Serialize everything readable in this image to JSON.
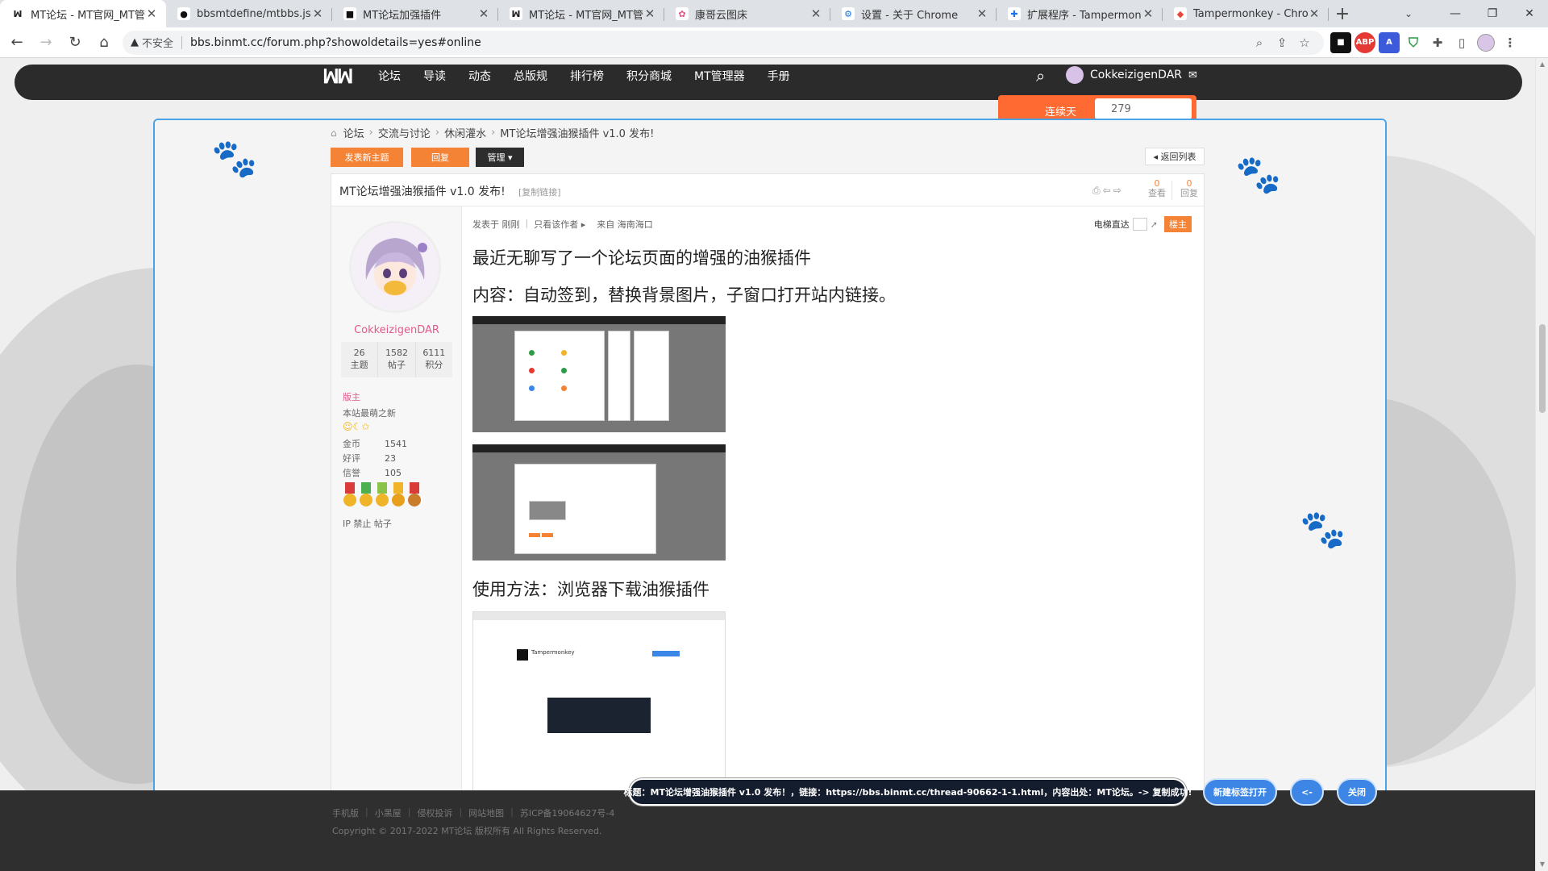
{
  "browser": {
    "tabs": [
      {
        "title": "MT论坛 - MT官网_MT管理器",
        "fav": "ꟽ",
        "fav_bg": "#ffffff",
        "fav_color": "#222222",
        "active": true
      },
      {
        "title": "bbsmtdefine/mtbbs.js at",
        "fav": "●",
        "fav_bg": "#ffffff",
        "fav_color": "#111111",
        "active": false
      },
      {
        "title": "MT论坛加强插件",
        "fav": "■",
        "fav_bg": "#ffffff",
        "fav_color": "#111111",
        "active": false
      },
      {
        "title": "MT论坛 - MT官网_MT管理器",
        "fav": "ꟽ",
        "fav_bg": "#ffffff",
        "fav_color": "#222222",
        "active": false
      },
      {
        "title": "康哥云图床",
        "fav": "✿",
        "fav_bg": "#ffffff",
        "fav_color": "#e0508c",
        "active": false
      },
      {
        "title": "设置 - 关于 Chrome",
        "fav": "⚙",
        "fav_bg": "#ffffff",
        "fav_color": "#1a73e8",
        "active": false
      },
      {
        "title": "扩展程序 - Tampermonkey",
        "fav": "✚",
        "fav_bg": "#ffffff",
        "fav_color": "#1a73e8",
        "active": false
      },
      {
        "title": "Tampermonkey - Chrome",
        "fav": "◆",
        "fav_bg": "#ffffff",
        "fav_color": "#e8453c",
        "active": false
      }
    ],
    "new_tab": "+",
    "insecure_label": "不安全",
    "url": "bbs.binmt.cc/forum.php?showoldetails=yes#online"
  },
  "site": {
    "logo": "ꟽꟽ",
    "nav": [
      "论坛",
      "导读",
      "动态",
      "总版规",
      "排行榜",
      "积分商城",
      "MT管理器",
      "手册"
    ],
    "username": "CokkeizigenDAR",
    "peek_label": "连续天",
    "peek_count": "279"
  },
  "thread": {
    "breadcrumb": [
      "论坛",
      "交流与讨论",
      "休闲灌水",
      "MT论坛增强油猴插件 v1.0 发布!"
    ],
    "new_topic": "发表新主题",
    "reply": "回复",
    "manage": "管理 ▾",
    "back": "◂ 返回列表",
    "title": "MT论坛增强油猴插件 v1.0 发布!",
    "copy_link": "[复制链接]",
    "views": "0",
    "views_label": "查看",
    "replies": "0",
    "replies_label": "回复"
  },
  "author": {
    "name": "CokkeizigenDAR",
    "stats": [
      {
        "value": "26",
        "label": "主题"
      },
      {
        "value": "1582",
        "label": "帖子"
      },
      {
        "value": "6111",
        "label": "积分"
      }
    ],
    "role": "版主",
    "title": "本站最萌之新",
    "stars": "☺☾✩",
    "info": [
      {
        "k": "金币",
        "v": "1541"
      },
      {
        "k": "好评",
        "v": "23"
      },
      {
        "k": "信誉",
        "v": "105"
      }
    ],
    "links": "IP 禁止 帖子"
  },
  "post": {
    "meta": [
      "发表于 刚刚",
      "只看该作者 ▸",
      "来自 海南海口"
    ],
    "elevator": "电梯直达",
    "floor_badge": "楼主",
    "lines": [
      "最近无聊写了一个论坛页面的增强的油猴插件",
      "内容：自动签到，替换背景图片，子窗口打开站内链接。",
      "使用方法：浏览器下载油猴插件"
    ],
    "shot_text": "Tampermonkey"
  },
  "footer": {
    "links": [
      "手机版",
      "小黑屋",
      "侵权投诉",
      "网站地图",
      "苏ICP备19064627号-4"
    ],
    "copyright": "Copyright © 2017-2022 MT论坛 版权所有 All Rights Reserved."
  },
  "overlay": {
    "toast": "标题：MT论坛增强油猴插件 v1.0 发布！，链接：https://bbs.binmt.cc/thread-90662-1-1.html，内容出处：MT论坛。-> 复制成功!",
    "new_tab_btn": "新建标签打开",
    "prev_btn": "<-",
    "close_btn": "关闭"
  },
  "colors": {
    "accent": "#f58335",
    "nav_bg": "#2b2b2b",
    "popup_border": "#4aa3e6",
    "username": "#e25a8c"
  }
}
